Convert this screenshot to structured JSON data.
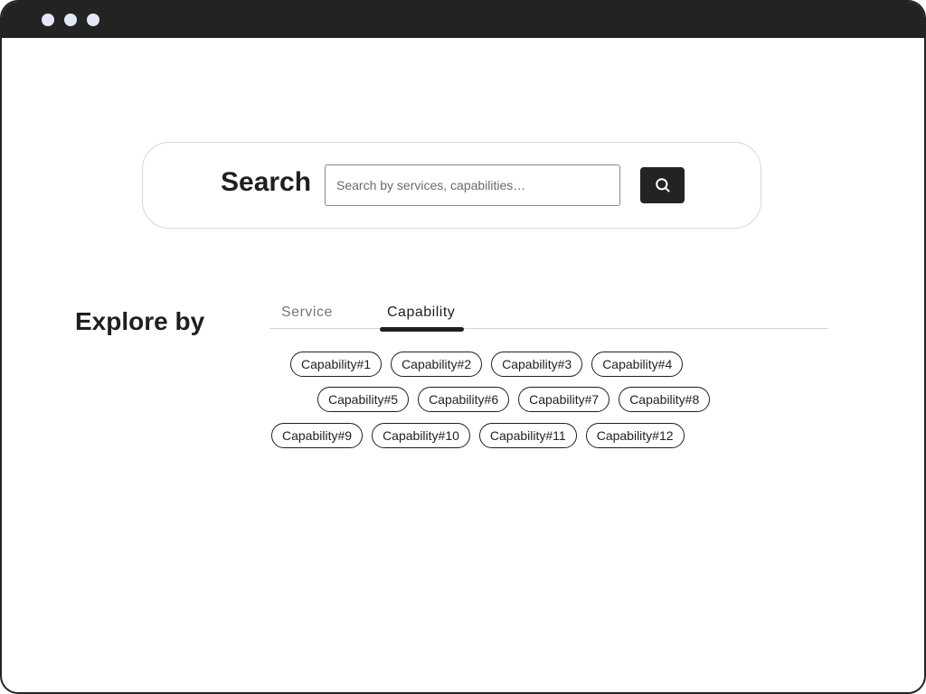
{
  "search": {
    "label": "Search",
    "placeholder": "Search by services, capabilities…",
    "value": ""
  },
  "explore": {
    "title": "Explore by",
    "tabs": [
      {
        "label": "Service",
        "active": false
      },
      {
        "label": "Capability",
        "active": true
      }
    ],
    "chips": [
      [
        "Capability#1",
        "Capability#2",
        "Capability#3",
        "Capability#4"
      ],
      [
        "Capability#5",
        "Capability#6",
        "Capability#7",
        "Capability#8"
      ],
      [
        "Capability#9",
        "Capability#10",
        "Capability#11",
        "Capability#12"
      ]
    ]
  },
  "icons": {
    "search_button": "search-icon"
  },
  "colors": {
    "titlebar": "#232323",
    "window_dots": "#e3e8f4",
    "accent": "#1f1f1f"
  }
}
